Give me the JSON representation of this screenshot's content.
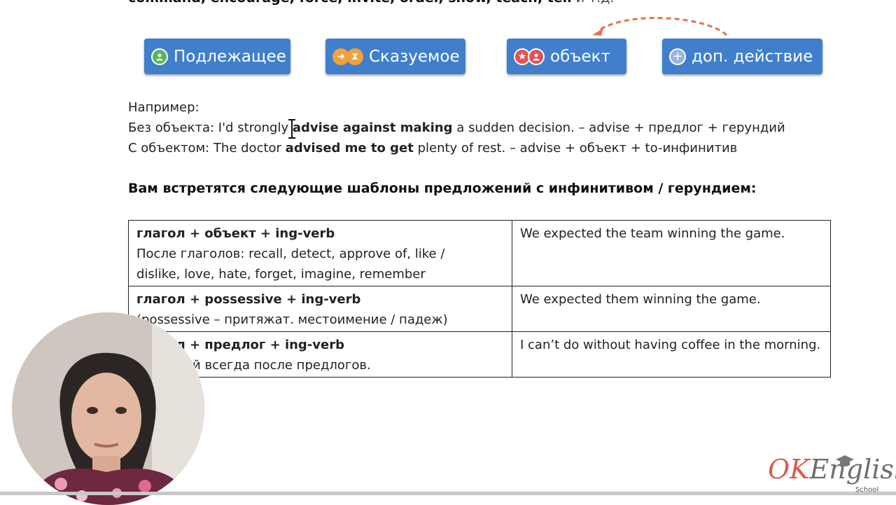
{
  "top_partial": {
    "bold": "command, encourage, force, invite, order, show, teach, tell",
    "rest": " и т.д."
  },
  "chips": [
    {
      "label": "Подлежащее"
    },
    {
      "label": "Сказуемое"
    },
    {
      "label": "объект"
    },
    {
      "label": "доп. действие"
    }
  ],
  "examples": {
    "intro": "Например:",
    "line1": {
      "prefix": "Без объекта: I'd strongly ",
      "bold": "advise against making",
      "suffix": " a sudden decision. – advise + предлог + герундий"
    },
    "line2": {
      "prefix": "С объектом: The doctor ",
      "bold": "advised me to get",
      "suffix": " plenty of rest. – advise + объект + to-инфинитив"
    }
  },
  "heading": "Вам встретятся следующие шаблоны предложений с инфинитивом / герундием:",
  "table": {
    "rows": [
      {
        "pattern": "глагол + объект + ing-verb",
        "note_lines": [
          "После глаголов: recall, detect, approve of, like /",
          "dislike, love, hate, forget, imagine, remember"
        ],
        "example": "We expected the team winning the game."
      },
      {
        "pattern": "глагол + possessive + ing-verb",
        "note_lines": [
          "(possessive – притяжат. местоимение / падеж)"
        ],
        "example": "We expected them winning the game."
      },
      {
        "pattern": "глагол + предлог + ing-verb",
        "note_lines": [
          "Герундий всегда после предлогов."
        ],
        "example": "I can’t do without having coffee in the morning."
      }
    ]
  },
  "logo": {
    "ok": "OK",
    "english": "English",
    "school": "School"
  },
  "colors": {
    "chip_blue": "#3f7fcc",
    "arrow": "#e8734a",
    "logo_red": "#d95b50"
  }
}
